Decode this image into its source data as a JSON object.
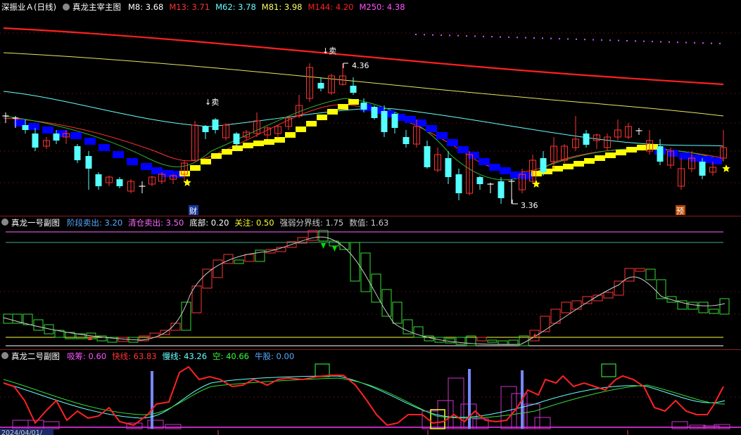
{
  "panel1": {
    "title": "深振业Ａ(日线)",
    "indicator": "真龙主宰主图",
    "ma_items": [
      {
        "label": "M8: 3.68",
        "color": "#ffffff"
      },
      {
        "label": "M13: 3.71",
        "color": "#ff3333"
      },
      {
        "label": "M62: 3.78",
        "color": "#66ffff"
      },
      {
        "label": "M81: 3.98",
        "color": "#ffff66"
      },
      {
        "label": "M144: 4.20",
        "color": "#ff2020"
      },
      {
        "label": "M250: 4.38",
        "color": "#ff55ff"
      }
    ],
    "sell_label": "↓卖",
    "high_value": "4.36",
    "low_value": "3.36",
    "badge_cai": "财",
    "badge_yu": "预"
  },
  "panel2": {
    "title": "真龙一号副图",
    "items": [
      {
        "label": "阶段卖出: 3.20",
        "color": "#55aaff"
      },
      {
        "label": "清仓卖出: 3.50",
        "color": "#ff66ff"
      },
      {
        "label": "底部: 0.20",
        "color": "#ffffff"
      },
      {
        "label": "关注: 0.50",
        "color": "#ffff33"
      },
      {
        "label": "强弱分界线: 1.75",
        "color": "#cccccc"
      },
      {
        "label": "数值: 1.63",
        "color": "#cccccc"
      }
    ]
  },
  "panel3": {
    "title": "真龙二号副图",
    "items": [
      {
        "label": "吸筹: 0.60",
        "color": "#ff55ff"
      },
      {
        "label": "快线: 63.83",
        "color": "#ff3333"
      },
      {
        "label": "慢线: 43.26",
        "color": "#66ffff"
      },
      {
        "label": "空: 40.66",
        "color": "#33ff33"
      },
      {
        "label": "牛股: 0.00",
        "color": "#55aaff"
      }
    ]
  },
  "footer": {
    "date": "2024/04/01/"
  },
  "colors": {
    "up": "#ff3333",
    "down": "#55ffff",
    "bg": "#000000",
    "grid": "#8b1a1a",
    "dragon_up": "#ffff00",
    "dragon_down": "#0000ff"
  }
}
